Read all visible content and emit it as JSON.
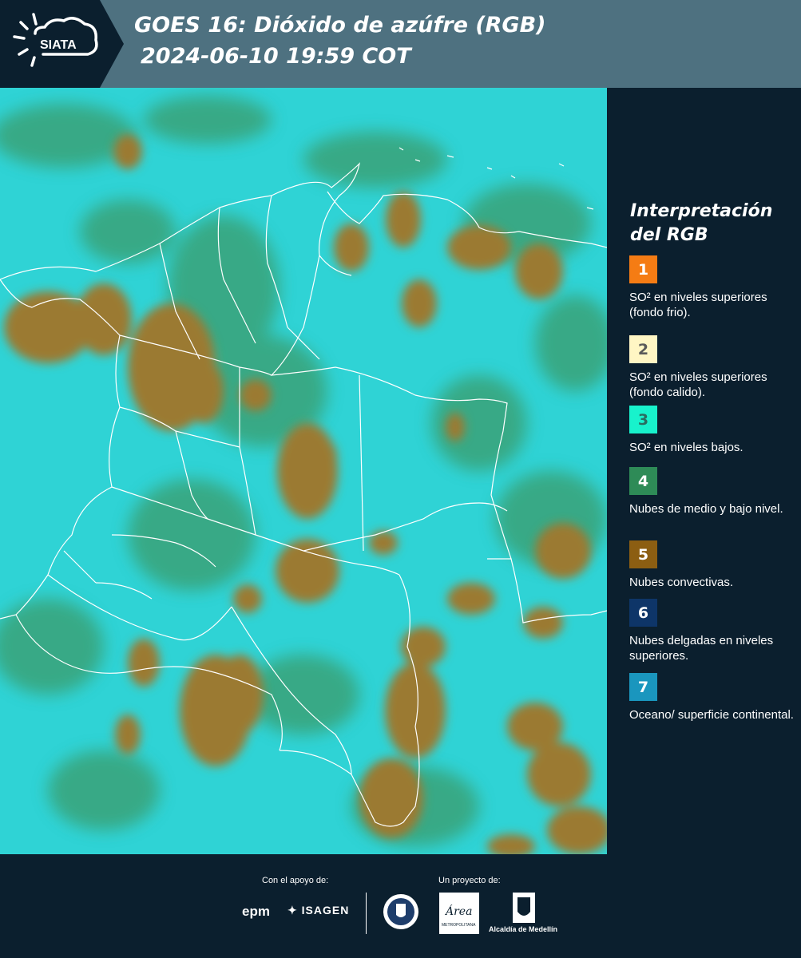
{
  "header": {
    "logo_text": "SIATA",
    "title_line1": "GOES 16: Dióxido de azúfre (RGB)",
    "title_line2": "2024-06-10 19:59 COT",
    "band_color": "#4e7180",
    "background_color": "#0b1f2e"
  },
  "legend": {
    "title": "Interpretación del RGB",
    "items": [
      {
        "number": "1",
        "label": "SO² en niveles superiores (fondo frio).",
        "color": "#f57c14",
        "text_color": "#ffffff"
      },
      {
        "number": "2",
        "label": "SO² en niveles superiores (fondo calido).",
        "color": "#fff6c4",
        "text_color": "#5a5a5a"
      },
      {
        "number": "3",
        "label": "SO² en niveles bajos.",
        "color": "#18f2cc",
        "text_color": "#2a6d60"
      },
      {
        "number": "4",
        "label": "Nubes de medio y bajo nivel.",
        "color": "#2e8b57",
        "text_color": "#ffffff"
      },
      {
        "number": "5",
        "label": "Nubes convectivas.",
        "color": "#8c5e12",
        "text_color": "#ffffff"
      },
      {
        "number": "6",
        "label": "Nubes delgadas en niveles superiores.",
        "color": "#0e3568",
        "text_color": "#ffffff"
      },
      {
        "number": "7",
        "label": "Oceano/ superficie continental.",
        "color": "#1a96be",
        "text_color": "#ffffff"
      }
    ]
  },
  "map": {
    "colors": {
      "background": "#2fd3d5",
      "low_cloud": "#3a9c6c",
      "convective": "#9b7a33",
      "boundary": "#ffffff"
    }
  },
  "footer": {
    "support_label": "Con el apoyo de:",
    "project_label": "Un proyecto de:",
    "epm": "epm",
    "isagen": "ISAGEN",
    "area_text": "Área",
    "area_subtext": "METROPOLITANA",
    "alcaldia": "Alcaldía de Medellín"
  }
}
